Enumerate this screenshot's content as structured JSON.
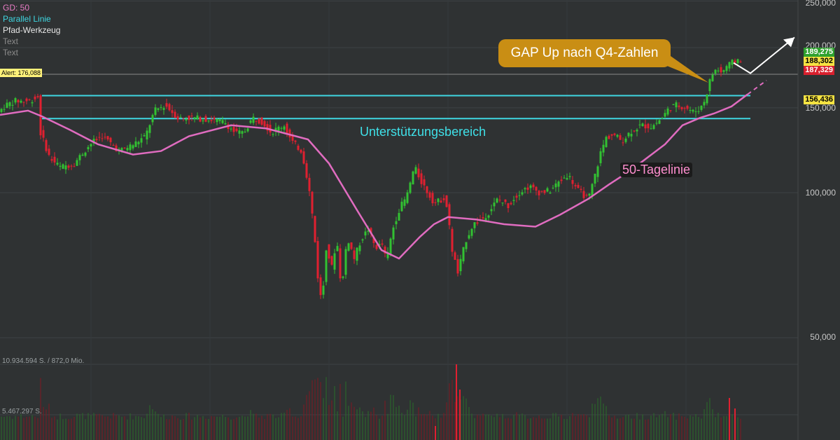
{
  "legend": {
    "items": [
      {
        "label": "GD: 50",
        "color": "#e87cc5"
      },
      {
        "label": "Parallel Linie",
        "color": "#3fd7e2"
      },
      {
        "label": "Pfad-Werkzeug",
        "color": "#e6e6e6"
      },
      {
        "label": "Text",
        "color": "#8c8c8c"
      },
      {
        "label": "Text",
        "color": "#8c8c8c"
      }
    ]
  },
  "alert": {
    "label": "Alert: 176,088",
    "value": 176.088
  },
  "price_tags": [
    {
      "label": "189,275",
      "bg": "#2ea12e",
      "fg": "#ffffff"
    },
    {
      "label": "188,302",
      "bg": "#f5e342",
      "fg": "#000000"
    },
    {
      "label": "187,329",
      "bg": "#d8202e",
      "fg": "#ffffff"
    },
    {
      "label": "156,436",
      "bg": "#f5e342",
      "fg": "#000000"
    }
  ],
  "volume_labels": [
    "10.934.594 S. / 872,0 Mio.",
    "5.467.297 S."
  ],
  "annotations": {
    "gap": "GAP Up nach Q4-Zahlen",
    "zone": "Unterstützungsbereich",
    "ma": "50-Tagelinie"
  },
  "colors": {
    "up": "#32c132",
    "down": "#e02030",
    "ma": "#e06cc0",
    "channel": "#3fd7e2",
    "grid": "#3e4244",
    "gap_box": "#c98e14"
  },
  "chart_data": {
    "type": "candlestick",
    "yscale": "log",
    "ylim": [
      37,
      250
    ],
    "yticks": [
      {
        "label": "250,000",
        "value": 250
      },
      {
        "label": "200,000",
        "value": 200
      },
      {
        "label": "150,000",
        "value": 150
      },
      {
        "label": "100,000",
        "value": 100
      },
      {
        "label": "50,000",
        "value": 50
      }
    ],
    "price_path": [
      [
        0,
        146
      ],
      [
        12,
        152
      ],
      [
        26,
        155
      ],
      [
        45,
        155
      ],
      [
        58,
        158
      ],
      [
        62,
        133
      ],
      [
        75,
        118
      ],
      [
        90,
        113
      ],
      [
        110,
        115
      ],
      [
        135,
        127
      ],
      [
        150,
        131
      ],
      [
        175,
        122
      ],
      [
        195,
        126
      ],
      [
        212,
        131
      ],
      [
        225,
        148
      ],
      [
        240,
        152
      ],
      [
        258,
        143
      ],
      [
        280,
        143
      ],
      [
        300,
        142
      ],
      [
        325,
        140
      ],
      [
        340,
        133
      ],
      [
        352,
        133
      ],
      [
        365,
        143
      ],
      [
        380,
        140
      ],
      [
        392,
        133
      ],
      [
        400,
        136
      ],
      [
        410,
        138
      ],
      [
        420,
        128
      ],
      [
        435,
        122
      ],
      [
        445,
        103
      ],
      [
        452,
        85
      ],
      [
        458,
        67
      ],
      [
        464,
        58
      ],
      [
        470,
        77
      ],
      [
        478,
        70
      ],
      [
        485,
        80
      ],
      [
        492,
        62
      ],
      [
        500,
        81
      ],
      [
        510,
        73
      ],
      [
        520,
        80
      ],
      [
        530,
        84
      ],
      [
        540,
        77
      ],
      [
        550,
        78
      ],
      [
        556,
        72
      ],
      [
        565,
        84
      ],
      [
        575,
        93
      ],
      [
        585,
        98
      ],
      [
        596,
        113
      ],
      [
        605,
        106
      ],
      [
        615,
        100
      ],
      [
        625,
        95
      ],
      [
        640,
        98
      ],
      [
        650,
        76
      ],
      [
        658,
        68
      ],
      [
        670,
        80
      ],
      [
        680,
        86
      ],
      [
        692,
        88
      ],
      [
        702,
        91
      ],
      [
        715,
        97
      ],
      [
        730,
        94
      ],
      [
        745,
        100
      ],
      [
        760,
        103
      ],
      [
        775,
        100
      ],
      [
        790,
        101
      ],
      [
        805,
        106
      ],
      [
        815,
        109
      ],
      [
        830,
        101
      ],
      [
        845,
        97
      ],
      [
        855,
        110
      ],
      [
        862,
        121
      ],
      [
        870,
        130
      ],
      [
        880,
        132
      ],
      [
        893,
        128
      ],
      [
        905,
        134
      ],
      [
        920,
        138
      ],
      [
        935,
        137
      ],
      [
        950,
        143
      ],
      [
        960,
        150
      ],
      [
        970,
        152
      ],
      [
        985,
        150
      ],
      [
        995,
        147
      ],
      [
        1005,
        150
      ],
      [
        1012,
        157
      ],
      [
        1020,
        175
      ],
      [
        1028,
        181
      ],
      [
        1035,
        177
      ],
      [
        1042,
        183
      ],
      [
        1050,
        186
      ],
      [
        1058,
        189
      ]
    ],
    "ma_path": [
      [
        0,
        145
      ],
      [
        40,
        148
      ],
      [
        60,
        144
      ],
      [
        100,
        135
      ],
      [
        140,
        126
      ],
      [
        190,
        120
      ],
      [
        230,
        122
      ],
      [
        270,
        131
      ],
      [
        330,
        138
      ],
      [
        380,
        136
      ],
      [
        440,
        129
      ],
      [
        470,
        115
      ],
      [
        510,
        92
      ],
      [
        545,
        76
      ],
      [
        570,
        73
      ],
      [
        600,
        81
      ],
      [
        620,
        86
      ],
      [
        640,
        89
      ],
      [
        680,
        88
      ],
      [
        720,
        86
      ],
      [
        765,
        85
      ],
      [
        800,
        90
      ],
      [
        840,
        97
      ],
      [
        870,
        104
      ],
      [
        900,
        111
      ],
      [
        950,
        126
      ],
      [
        975,
        138
      ],
      [
        1000,
        143
      ],
      [
        1020,
        146
      ],
      [
        1045,
        151
      ],
      [
        1068,
        160
      ]
    ],
    "channel": {
      "upper": 159,
      "lower": 142.5,
      "x_start": 60,
      "x_end": 1072
    },
    "alert_level": 176.088,
    "forecast_ma": [
      [
        1068,
        160
      ],
      [
        1095,
        171
      ]
    ],
    "forecast_arrow": [
      [
        1048,
        186
      ],
      [
        1072,
        177
      ],
      [
        1135,
        210
      ]
    ]
  }
}
